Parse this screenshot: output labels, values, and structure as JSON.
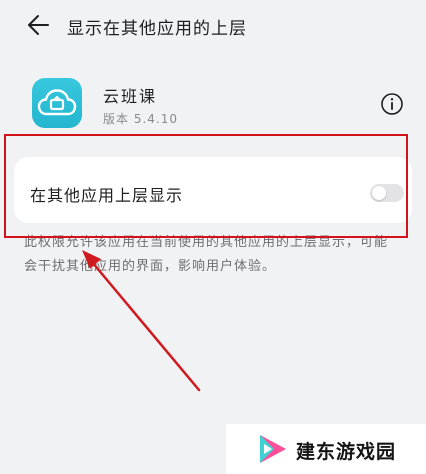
{
  "header": {
    "title": "显示在其他应用的上层"
  },
  "app": {
    "name": "云班课",
    "version": "版本 5.4.10"
  },
  "setting": {
    "label": "在其他应用上层显示",
    "enabled": false
  },
  "description": "此权限允许该应用在当前使用的其他应用的上层显示，可能会干扰其他应用的界面，影响用户体验。",
  "watermark": {
    "text": "建东游戏园"
  },
  "colors": {
    "annotation": "#d3131b",
    "app_icon": "#2bbcd4",
    "toggle_off": "#e3e3e5"
  },
  "icons": {
    "back": "arrow-left-icon",
    "info": "info-circle-icon"
  }
}
